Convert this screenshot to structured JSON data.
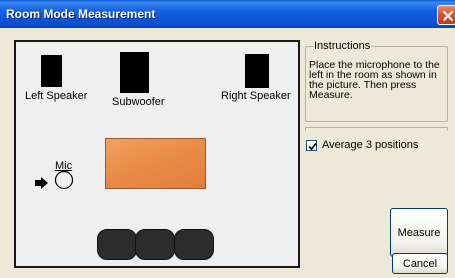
{
  "window": {
    "title": "Room Mode Measurement",
    "close_icon": "close-icon"
  },
  "room": {
    "speakers": {
      "left": "Left Speaker",
      "sub": "Subwoofer",
      "right": "Right Speaker"
    },
    "mic_label": "Mic",
    "table_color": "#e98b46"
  },
  "instructions": {
    "legend": "Instructions",
    "text": "Place the microphone to the left in the room as shown in the picture. Then press Measure."
  },
  "options": {
    "average_label": "Average 3 positions",
    "average_checked": true
  },
  "buttons": {
    "measure": "Measure",
    "cancel": "Cancel"
  }
}
